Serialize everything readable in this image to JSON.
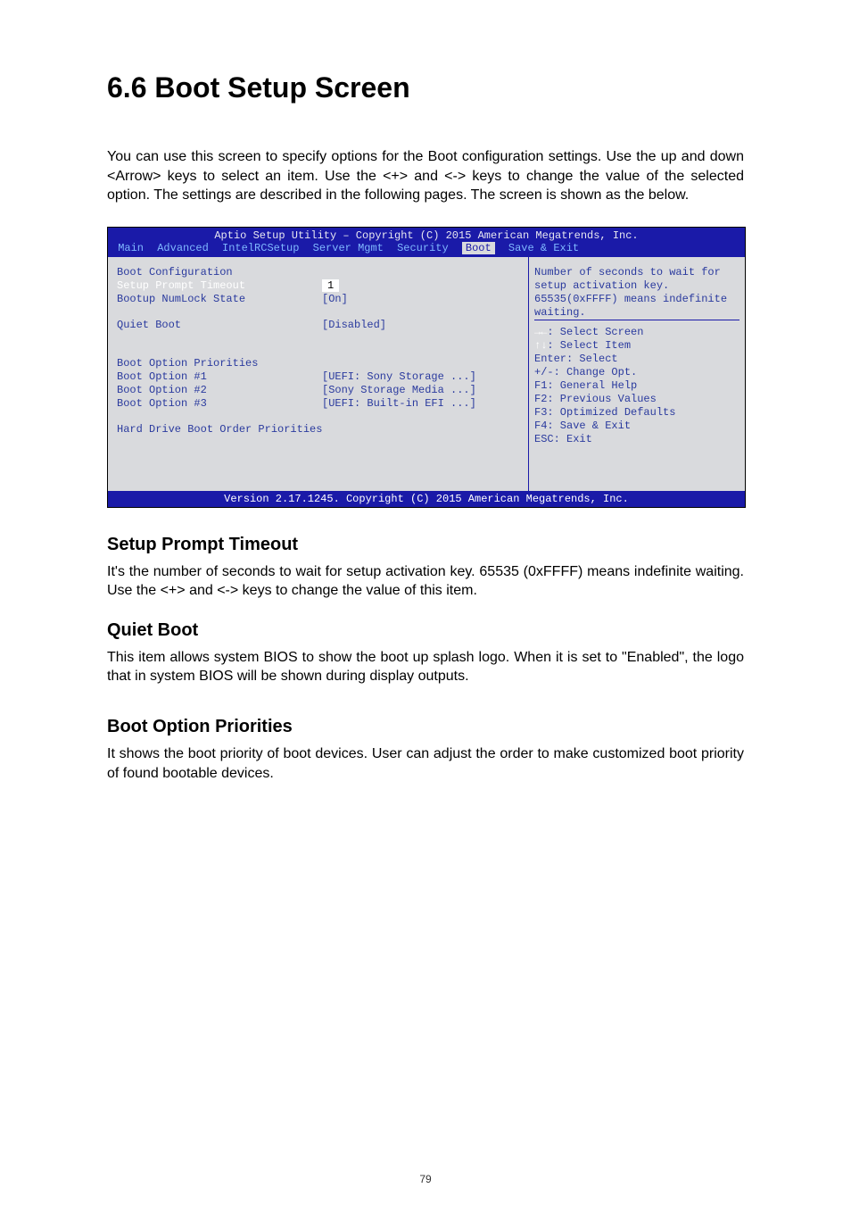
{
  "page_number": "79",
  "title": "6.6 Boot Setup Screen",
  "intro": "You can use this screen to specify options for the Boot configuration settings. Use the up and down <Arrow> keys to select an item. Use the <+> and <-> keys to change the value of the selected option. The settings are described in the following pages. The screen is shown as the below.",
  "bios": {
    "header": "Aptio Setup Utility – Copyright (C) 2015 American Megatrends, Inc.",
    "menu": {
      "items": [
        "Main",
        "Advanced",
        "IntelRCSetup",
        "Server Mgmt",
        "Security",
        "Boot",
        "Save & Exit"
      ],
      "selected": "Boot"
    },
    "left": {
      "heading1": "Boot Configuration",
      "opt1_label": "Setup Prompt Timeout",
      "opt1_value": "1",
      "opt2_label": "Bootup NumLock State",
      "opt2_value": "[On]",
      "opt3_label": "Quiet Boot",
      "opt3_value": "[Disabled]",
      "heading2": "Boot Option Priorities",
      "bo1_label": "Boot Option #1",
      "bo1_value": "[UEFI: Sony Storage ...]",
      "bo2_label": "Boot Option #2",
      "bo2_value": "[Sony Storage Media ...]",
      "bo3_label": "Boot Option #3",
      "bo3_value": "[UEFI: Built-in EFI ...]",
      "heading3": "Hard Drive Boot Order Priorities"
    },
    "right": {
      "help": "Number of seconds to wait for setup activation key. 65535(0xFFFF) means indefinite waiting.",
      "keys": {
        "k1p": "→←",
        "k1": ": Select Screen",
        "k2p": "↑↓",
        "k2": ": Select Item",
        "k3": "Enter: Select",
        "k4": "+/-: Change Opt.",
        "k5": "F1: General Help",
        "k6": "F2: Previous Values",
        "k7": "F3: Optimized Defaults",
        "k8": "F4: Save & Exit",
        "k9": "ESC: Exit"
      }
    },
    "footer": "Version 2.17.1245. Copyright (C) 2015 American Megatrends, Inc."
  },
  "sec1_title": "Setup Prompt Timeout",
  "sec1_body": "It's the number of seconds to wait for setup activation key. 65535 (0xFFFF) means indefinite waiting. Use the <+> and <-> keys to change the value of this item.",
  "sec2_title": "Quiet Boot",
  "sec2_body": "This item allows system BIOS to show the boot up splash logo. When it is set to \"Enabled\", the logo that in system BIOS will be shown during display outputs.",
  "sec3_title": "Boot Option Priorities",
  "sec3_body": "It shows the boot priority of boot devices. User can adjust the order to make customized boot priority of found bootable devices."
}
